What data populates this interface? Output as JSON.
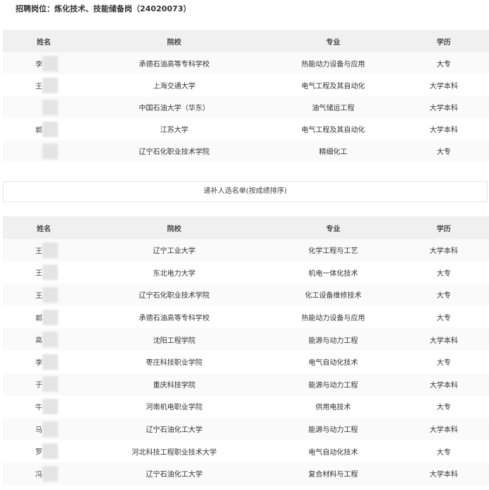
{
  "page_title": "招聘岗位：炼化技术、技能储备岗（24020073）",
  "headers": {
    "name": "姓名",
    "school": "院校",
    "major": "专业",
    "edu": "学历"
  },
  "admitted": [
    {
      "name": "李",
      "school": "承德石油高等专科学校",
      "major": "热能动力设备与应用",
      "edu": "大专"
    },
    {
      "name": "王",
      "school": "上海交通大学",
      "major": "电气工程及其自动化",
      "edu": "大学本科"
    },
    {
      "name": "",
      "school": "中国石油大学（华东）",
      "major": "油气储运工程",
      "edu": "大学本科"
    },
    {
      "name": "郭",
      "school": "江苏大学",
      "major": "电气工程及其自动化",
      "edu": "大学本科"
    },
    {
      "name": "",
      "school": "辽宁石化职业技术学院",
      "major": "精细化工",
      "edu": "大专"
    }
  ],
  "supplement_title": "递补人选名单(按成绩排序)",
  "supplement": [
    {
      "name": "王",
      "school": "辽宁工业大学",
      "major": "化学工程与工艺",
      "edu": "大学本科"
    },
    {
      "name": "王",
      "school": "东北电力大学",
      "major": "机电一体化技术",
      "edu": "大专"
    },
    {
      "name": "王",
      "school": "辽宁石化职业技术学院",
      "major": "化工设备维修技术",
      "edu": "大专"
    },
    {
      "name": "郭",
      "school": "承德石油高等专科学校",
      "major": "热能动力设备与应用",
      "edu": "大专"
    },
    {
      "name": "高",
      "school": "沈阳工程学院",
      "major": "能源与动力工程",
      "edu": "大学本科"
    },
    {
      "name": "李",
      "school": "枣庄科技职业学院",
      "major": "电气自动化技术",
      "edu": "大专"
    },
    {
      "name": "于",
      "school": "重庆科技学院",
      "major": "能源与动力工程",
      "edu": "大学本科"
    },
    {
      "name": "牛",
      "school": "河南机电职业学院",
      "major": "供用电技术",
      "edu": "大专"
    },
    {
      "name": "马",
      "school": "辽宁石油化工大学",
      "major": "能源与动力工程",
      "edu": "大学本科"
    },
    {
      "name": "罗",
      "school": "河北科技工程职业技术大学",
      "major": "电气自动化技术",
      "edu": "大专"
    },
    {
      "name": "冯",
      "school": "辽宁石油化工大学",
      "major": "复合材料与工程",
      "edu": "大学本科"
    }
  ]
}
